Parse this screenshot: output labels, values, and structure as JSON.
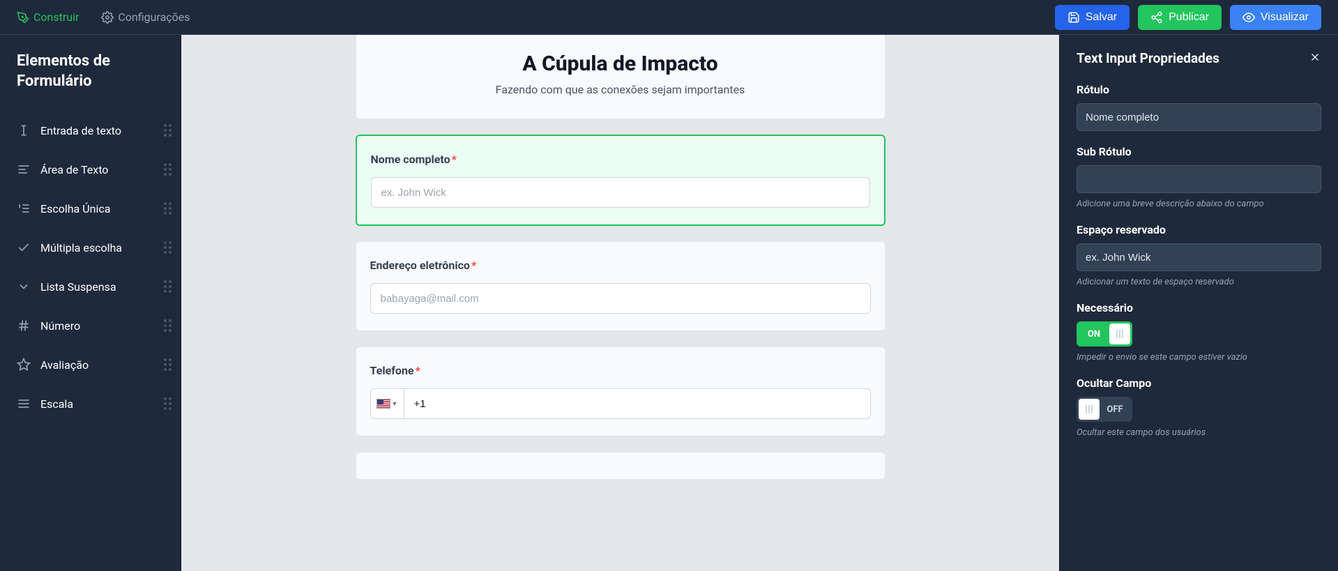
{
  "topbar": {
    "build": "Construir",
    "settings": "Configurações",
    "save": "Salvar",
    "publish": "Publicar",
    "visualize": "Visualizar"
  },
  "left": {
    "title": "Elementos de Formulário",
    "items": [
      {
        "label": "Entrada de texto"
      },
      {
        "label": "Área de Texto"
      },
      {
        "label": "Escolha Única"
      },
      {
        "label": "Múltipla escolha"
      },
      {
        "label": "Lista Suspensa"
      },
      {
        "label": "Número"
      },
      {
        "label": "Avaliação"
      },
      {
        "label": "Escala"
      }
    ]
  },
  "form": {
    "title": "A Cúpula de Impacto",
    "subtitle": "Fazendo com que as conexões sejam importantes",
    "fields": {
      "name": {
        "label": "Nome completo",
        "placeholder": "ex. John Wick"
      },
      "email": {
        "label": "Endereço eletrônico",
        "placeholder": "babayaga@mail.com"
      },
      "phone": {
        "label": "Telefone",
        "prefix": "+1"
      }
    }
  },
  "right": {
    "title": "Text Input Propriedades",
    "rotuloLabel": "Rótulo",
    "rotuloValue": "Nome completo",
    "subRotuloLabel": "Sub Rótulo",
    "subRotuloHint": "Adicione uma breve descrição abaixo do campo",
    "placeholderLabel": "Espaço reservado",
    "placeholderValue": "ex. John Wick",
    "placeholderHint": "Adicionar um texto de espaço reservado",
    "requiredLabel": "Necessário",
    "requiredToggle": "ON",
    "requiredHint": "Impedir o envio se este campo estiver vazio",
    "hideLabel": "Ocultar Campo",
    "hideToggle": "OFF",
    "hideHint": "Ocultar este campo dos usuários"
  }
}
